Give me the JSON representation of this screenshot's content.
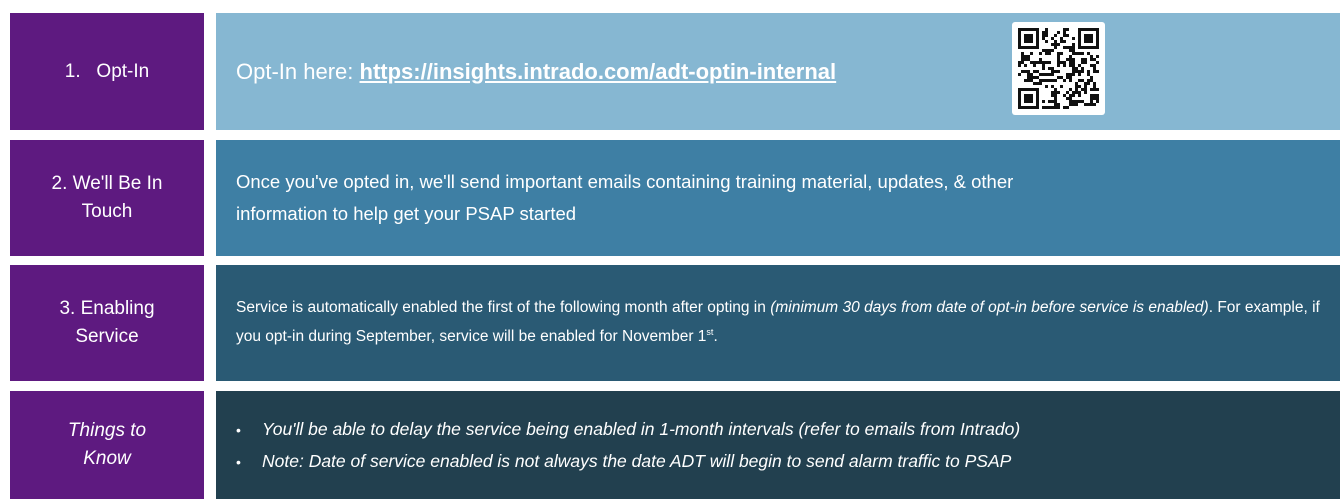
{
  "rows": {
    "optin": {
      "label": "1.   Opt-In",
      "prefix": "Opt-In here: ",
      "link": "https://insights.intrado.com/adt-optin-internal",
      "qr_icon": "qr-code-icon"
    },
    "touch": {
      "label_line1": "2. We'll Be In",
      "label_line2": "Touch",
      "text_line1": "Once you've opted in, we'll send important emails containing training material, updates, & other",
      "text_line2": "information to help get your PSAP started"
    },
    "enabling": {
      "label_line1": "3. Enabling",
      "label_line2": "Service",
      "text_part1": "Service is automatically enabled the first of the following month after opting in ",
      "text_italic": "(minimum 30 days from date of opt-in before service is enabled)",
      "text_part2": ". For example, if you opt-in during September, service will be enabled for November 1",
      "text_sup": "st",
      "text_end": "."
    },
    "know": {
      "label_line1": "Things to",
      "label_line2": "Know",
      "bullet1": "You'll be able to delay the service being enabled in 1-month intervals (refer to emails from Intrado)",
      "bullet2": "Note: Date of service enabled is not always the date ADT will begin to send alarm traffic to PSAP"
    }
  },
  "colors": {
    "label_bg": "#5e1a80",
    "row1_bg": "#86b7d2",
    "row2_bg": "#3e7fa4",
    "row3_bg": "#2a5a74",
    "row4_bg": "#22404f"
  }
}
